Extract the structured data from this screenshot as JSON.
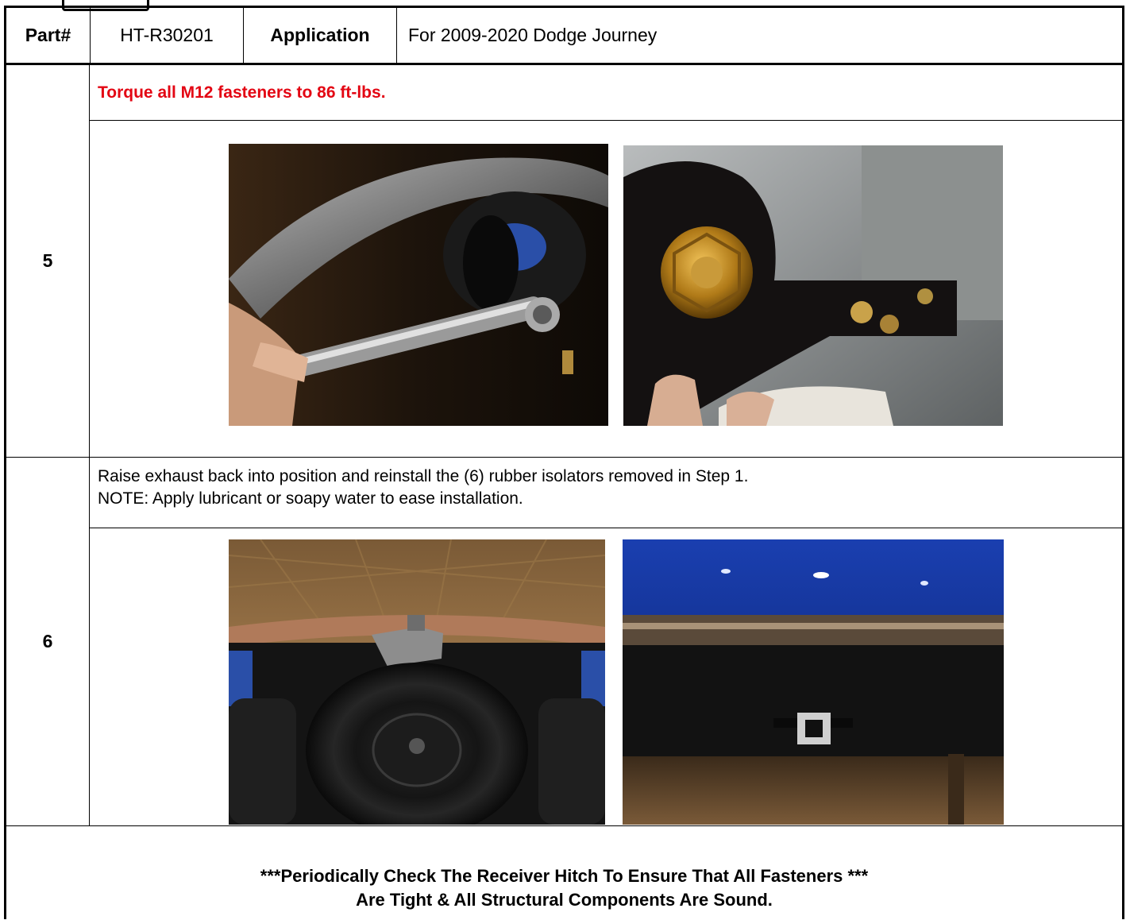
{
  "header": {
    "part_label": "Part#",
    "part_number": "HT-R30201",
    "application_label": "Application",
    "application_value": "For 2009-2020 Dodge Journey"
  },
  "steps": [
    {
      "number": "5",
      "instruction": "Torque all M12 fasteners to 86 ft-lbs.",
      "instruction_color": "#e30613"
    },
    {
      "number": "6",
      "instruction_line1": "Raise exhaust back into position and reinstall the (6) rubber isolators removed in Step 1.",
      "instruction_line2": "NOTE: Apply lubricant or soapy water to ease installation."
    }
  ],
  "footer": {
    "line1": "***Periodically Check The Receiver Hitch To Ensure That All Fasteners ***",
    "line2": "Are Tight & All Structural Components Are Sound."
  }
}
